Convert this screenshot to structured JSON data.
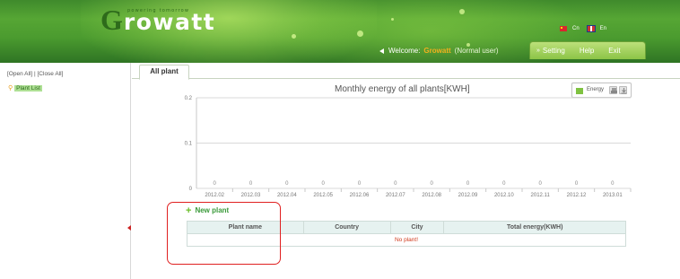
{
  "header": {
    "logo_text": "Growatt",
    "logo_tagline": "powering tomorrow",
    "languages": [
      {
        "label": "Cn",
        "flag": "china-flag-icon"
      },
      {
        "label": "En",
        "flag": "uk-flag-icon"
      }
    ],
    "welcome_label": "Welcome:",
    "welcome_user": "Growatt",
    "user_role": "(Normal user)",
    "nav": {
      "setting": "Setting",
      "help": "Help",
      "exit": "Exit"
    },
    "colors": {
      "brand_green": "#4b9b2f",
      "user_highlight": "#f2b01e"
    }
  },
  "sidebar": {
    "open_all": "[Open All]",
    "close_all": "[Close All]",
    "separator": " | ",
    "plant_list": "Plant List"
  },
  "tabs": [
    {
      "label": "All plant",
      "active": true
    }
  ],
  "chart": {
    "title": "Monthly energy of all plants[KWH]",
    "legend_label": "Energy"
  },
  "chart_data": {
    "type": "bar",
    "title": "Monthly energy of all plants[KWH]",
    "categories": [
      "2012.02",
      "2012.03",
      "2012.04",
      "2012.05",
      "2012.06",
      "2012.07",
      "2012.08",
      "2012.09",
      "2012.10",
      "2012.11",
      "2012.12",
      "2013.01"
    ],
    "series": [
      {
        "name": "Energy",
        "values": [
          0,
          0,
          0,
          0,
          0,
          0,
          0,
          0,
          0,
          0,
          0,
          0
        ]
      }
    ],
    "data_labels": [
      "0",
      "0",
      "0",
      "0",
      "0",
      "0",
      "0",
      "0",
      "0",
      "0",
      "0",
      "0"
    ],
    "y_ticks": [
      "0",
      "0.1",
      "0.2"
    ],
    "ylim": [
      0,
      0.2
    ],
    "grid": true,
    "legend": "top-right",
    "colors": {
      "series": "#7fc241",
      "grid": "#d9d9d9"
    }
  },
  "plant_section": {
    "new_plant_label": "New plant",
    "columns": [
      "Plant name",
      "Country",
      "City",
      "Total energy(KWH)"
    ],
    "empty_message": "No plant!"
  }
}
